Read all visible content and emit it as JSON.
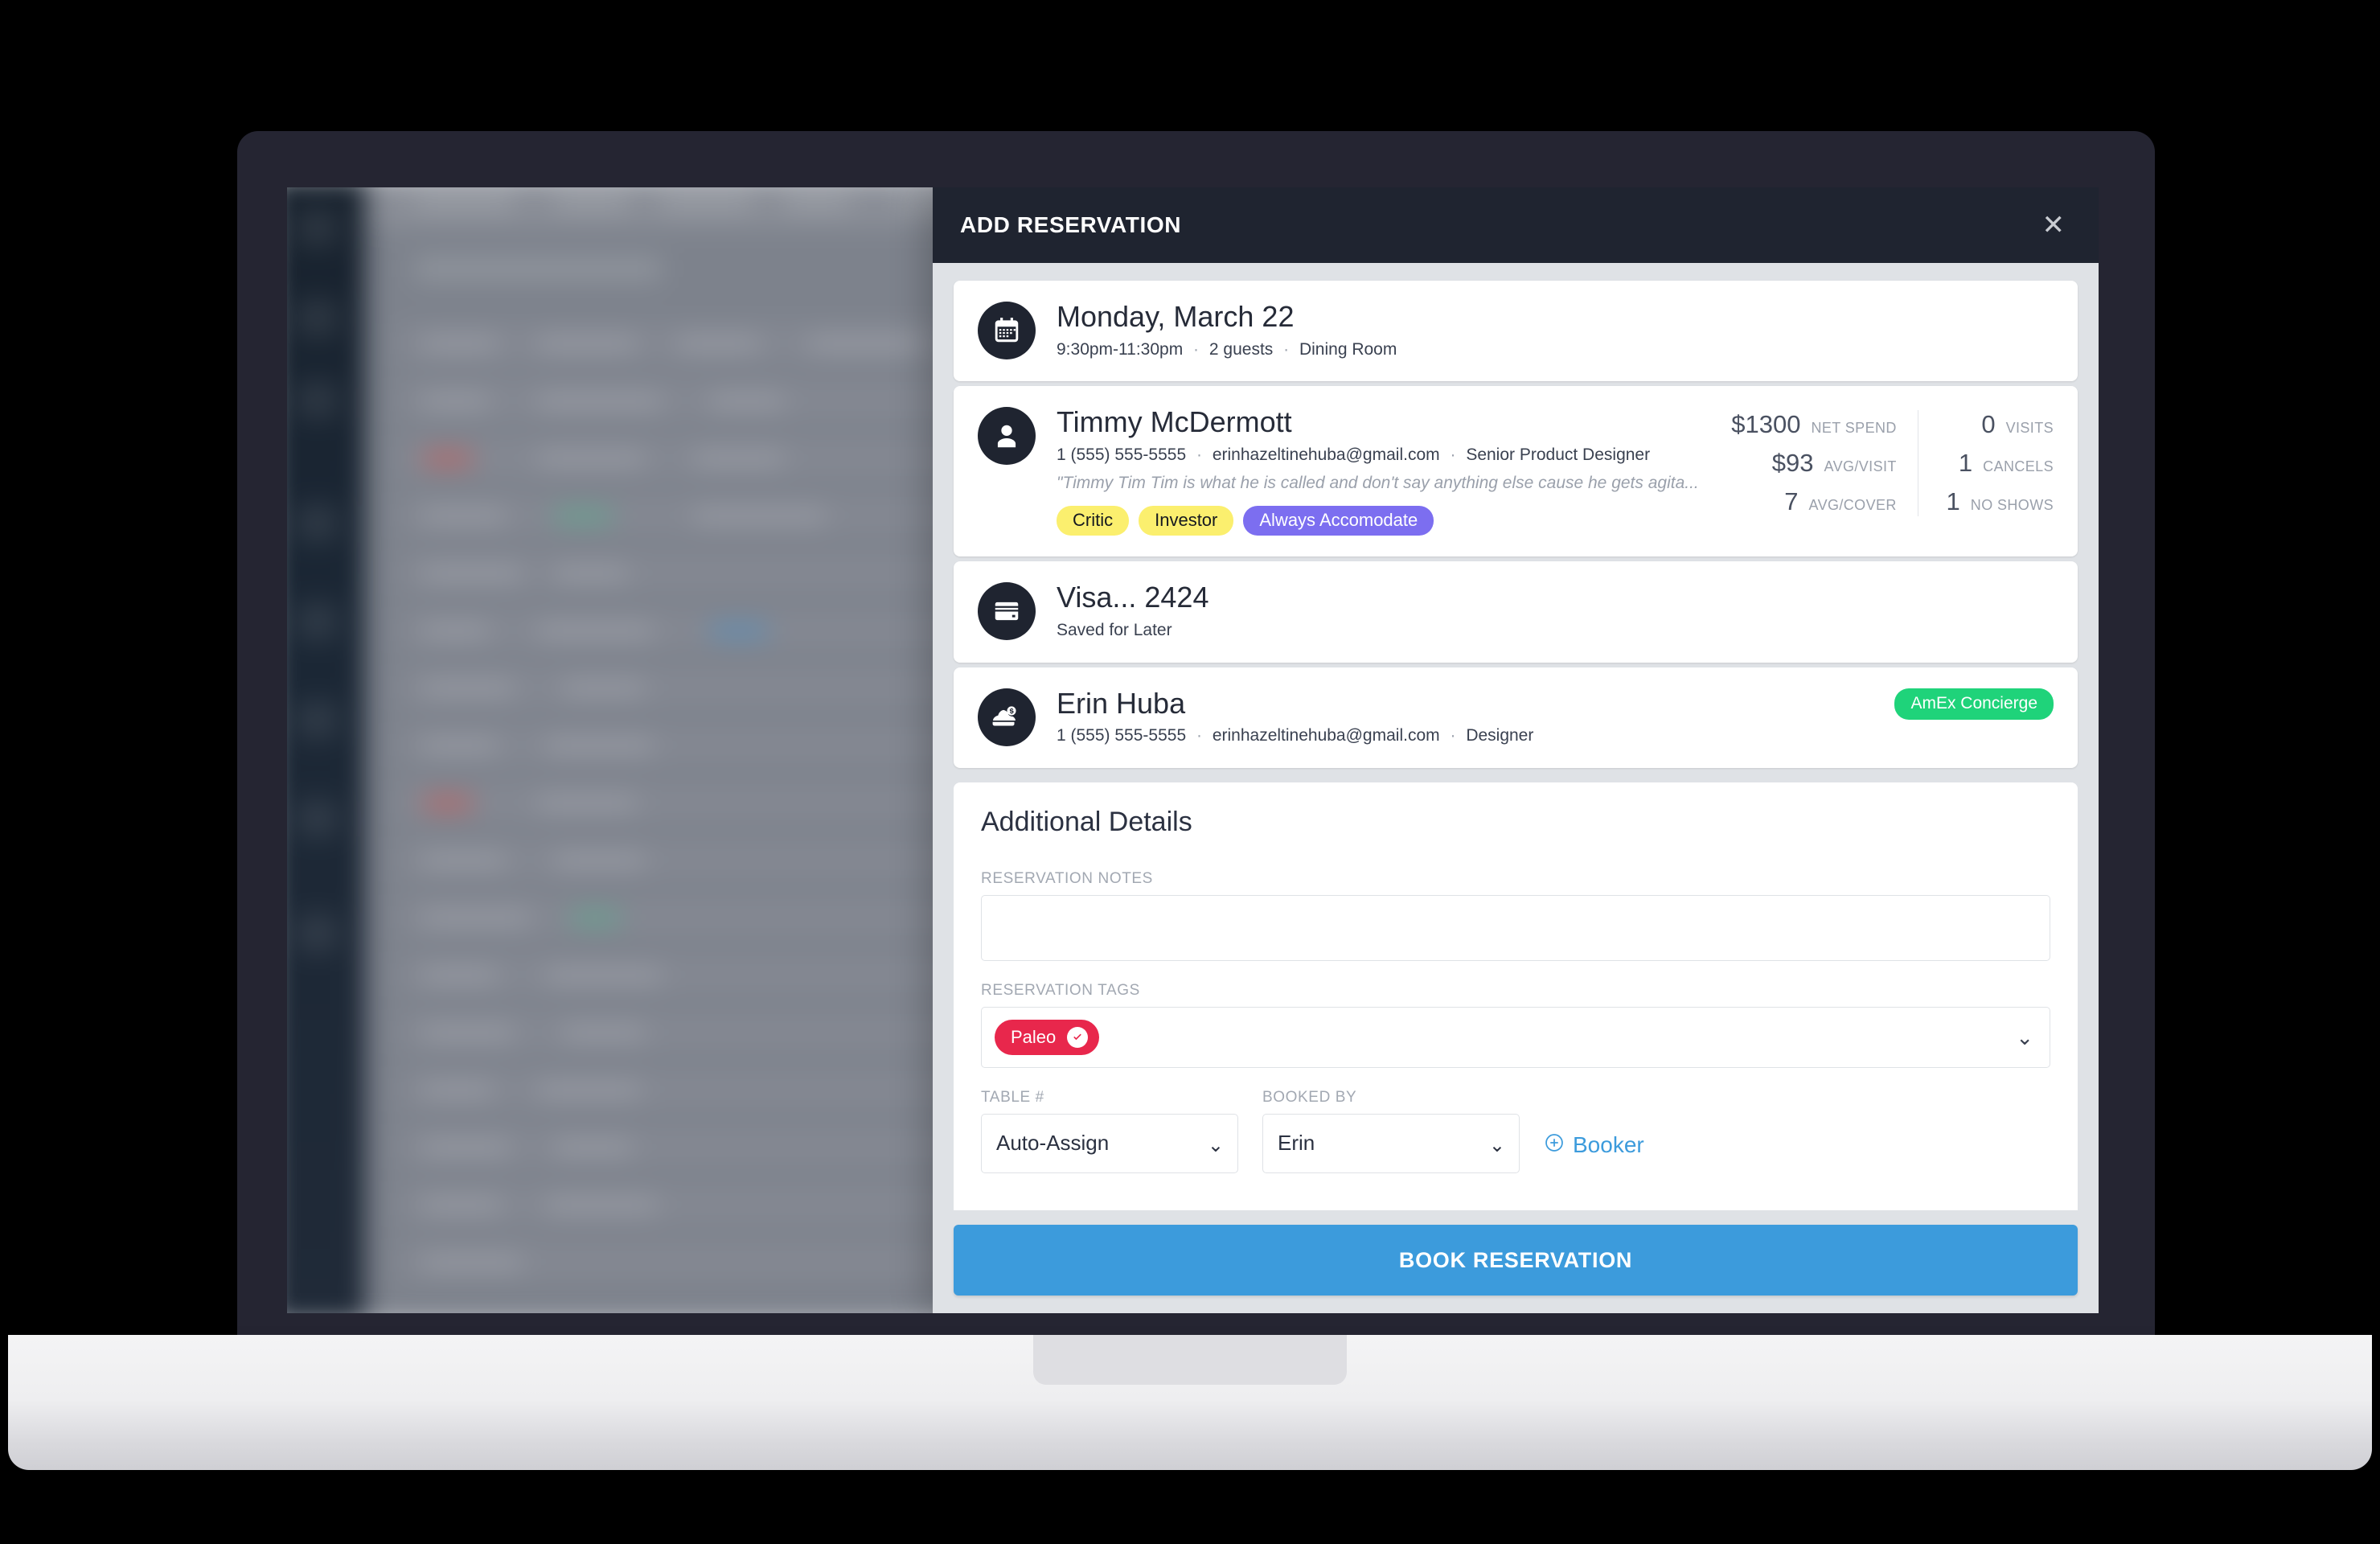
{
  "modal": {
    "title": "ADD RESERVATION",
    "close_icon": "close-icon"
  },
  "reservation": {
    "icon": "calendar-icon",
    "date": "Monday, March 22",
    "time": "9:30pm-11:30pm",
    "guests": "2 guests",
    "area": "Dining Room"
  },
  "guest": {
    "icon": "person-icon",
    "name": "Timmy McDermott",
    "phone": "1 (555) 555-5555",
    "email": "erinhazeltinehuba@gmail.com",
    "title": "Senior Product Designer",
    "note": "\"Timmy Tim Tim is what he is called and don't say anything else cause he gets agita...",
    "tags": [
      {
        "label": "Critic",
        "color": "#fbef6e",
        "text_color": "#15181f"
      },
      {
        "label": "Investor",
        "color": "#fbef6e",
        "text_color": "#15181f"
      },
      {
        "label": "Always Accomodate",
        "color": "#7c6ef0",
        "text_color": "#ffffff"
      }
    ],
    "stats_left": [
      {
        "value": "$1300",
        "label": "NET SPEND"
      },
      {
        "value": "$93",
        "label": "AVG/VISIT"
      },
      {
        "value": "7",
        "label": "AVG/COVER"
      }
    ],
    "stats_right": [
      {
        "value": "0",
        "label": "VISITS"
      },
      {
        "value": "1",
        "label": "CANCELS"
      },
      {
        "value": "1",
        "label": "NO SHOWS"
      }
    ]
  },
  "payment": {
    "icon": "credit-card-icon",
    "card": "Visa... 2424",
    "status": "Saved for Later"
  },
  "booker": {
    "icon": "concierge-icon",
    "name": "Erin Huba",
    "phone": "1 (555) 555-5555",
    "email": "erinhazeltinehuba@gmail.com",
    "title": "Designer",
    "badge": "AmEx Concierge",
    "badge_color": "#1fd37a"
  },
  "details": {
    "heading": "Additional Details",
    "notes_label": "RESERVATION NOTES",
    "notes_value": "",
    "notes_placeholder": "",
    "tags_label": "RESERVATION TAGS",
    "tag_pill": "Paleo",
    "tag_pill_color": "#e8274c",
    "table_label": "TABLE #",
    "table_value": "Auto-Assign",
    "booked_by_label": "BOOKED BY",
    "booked_by_value": "Erin",
    "add_booker_label": "Booker",
    "add_booker_icon": "plus-circle-icon",
    "caret_icon": "chevron-down-icon"
  },
  "footer": {
    "book_label": "BOOK RESERVATION",
    "book_color": "#3c9bdc"
  }
}
